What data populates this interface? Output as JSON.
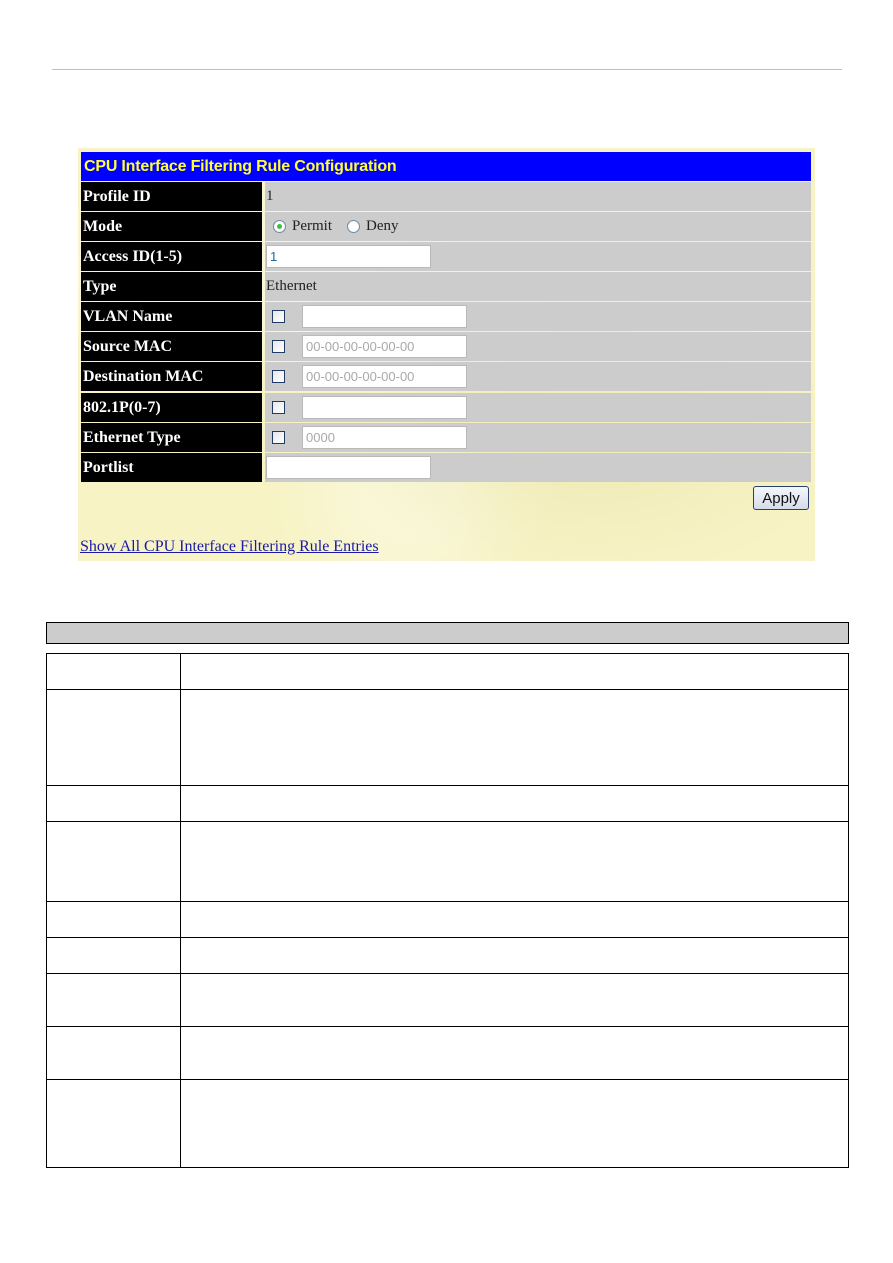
{
  "panel": {
    "title": "CPU Interface Filtering Rule Configuration",
    "rows": {
      "profile_id": {
        "label": "Profile ID",
        "value": "1"
      },
      "mode": {
        "label": "Mode",
        "options": [
          "Permit",
          "Deny"
        ],
        "selected": "Permit"
      },
      "access_id": {
        "label": "Access ID(1-5)",
        "value": "1"
      },
      "type": {
        "label": "Type",
        "value": "Ethernet"
      },
      "vlan_name": {
        "label": "VLAN Name",
        "checked": false,
        "value": "",
        "placeholder": ""
      },
      "source_mac": {
        "label": "Source MAC",
        "checked": false,
        "value": "",
        "placeholder": "00-00-00-00-00-00"
      },
      "destination_mac": {
        "label": "Destination MAC",
        "checked": false,
        "value": "",
        "placeholder": "00-00-00-00-00-00"
      },
      "priority_8021p": {
        "label": "802.1P(0-7)",
        "checked": false,
        "value": "",
        "placeholder": ""
      },
      "ethernet_type": {
        "label": "Ethernet Type",
        "checked": false,
        "value": "",
        "placeholder": "0000"
      },
      "portlist": {
        "label": "Portlist",
        "value": ""
      }
    },
    "apply_label": "Apply",
    "show_all_link": "Show All CPU Interface Filtering Rule Entries"
  },
  "colors": {
    "title_bg": "#0000ff",
    "title_text": "#ffff33",
    "label_bg": "#000000",
    "value_bg": "#cccccc",
    "panel_bg": "#f7f3c4",
    "link": "#1a1aa6"
  },
  "description_table": {
    "header": "",
    "rows": [
      {
        "param": "",
        "desc": ""
      },
      {
        "param": "",
        "desc": ""
      },
      {
        "param": "",
        "desc": ""
      },
      {
        "param": "",
        "desc": ""
      },
      {
        "param": "",
        "desc": ""
      },
      {
        "param": "",
        "desc": ""
      },
      {
        "param": "",
        "desc": ""
      },
      {
        "param": "",
        "desc": ""
      },
      {
        "param": "",
        "desc": ""
      }
    ]
  }
}
